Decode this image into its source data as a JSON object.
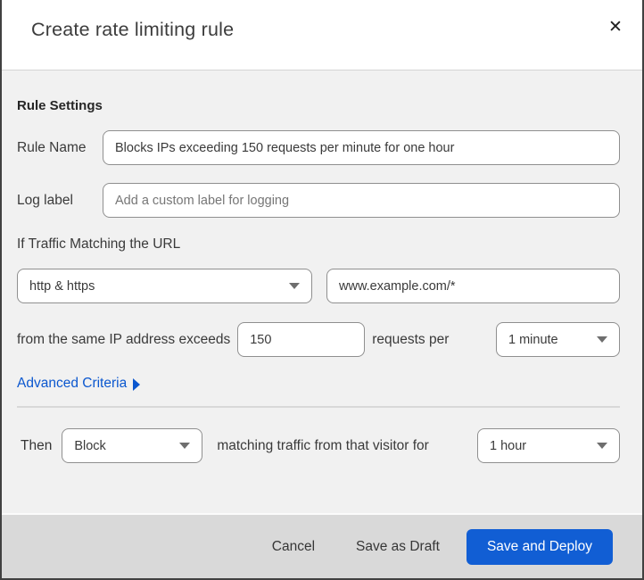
{
  "modal": {
    "title": "Create rate limiting rule",
    "close_glyph": "✕"
  },
  "rule_settings": {
    "heading": "Rule Settings",
    "rule_name": {
      "label": "Rule Name",
      "value": "Blocks IPs exceeding 150 requests per minute for one hour"
    },
    "log_label": {
      "label": "Log label",
      "placeholder": "Add a custom label for logging"
    },
    "traffic_match": {
      "heading": "If Traffic Matching the URL",
      "scheme_selected": "http & https",
      "url_value": "www.example.com/*"
    },
    "threshold": {
      "prefix": "from the same IP address exceeds",
      "requests_value": "150",
      "middle": "requests per",
      "period_selected": "1 minute"
    },
    "advanced_criteria_label": "Advanced Criteria"
  },
  "action": {
    "then_label": "Then",
    "action_selected": "Block",
    "middle": "matching traffic from that visitor for",
    "duration_selected": "1 hour"
  },
  "footer": {
    "cancel_label": "Cancel",
    "save_draft_label": "Save as Draft",
    "save_deploy_label": "Save and Deploy"
  },
  "colors": {
    "accent_blue": "#115ed4",
    "link_blue": "#0b57cf",
    "body_background": "#f1f1f1",
    "footer_background": "#d9d9d9",
    "page_sliver_navy": "#0d2333"
  }
}
